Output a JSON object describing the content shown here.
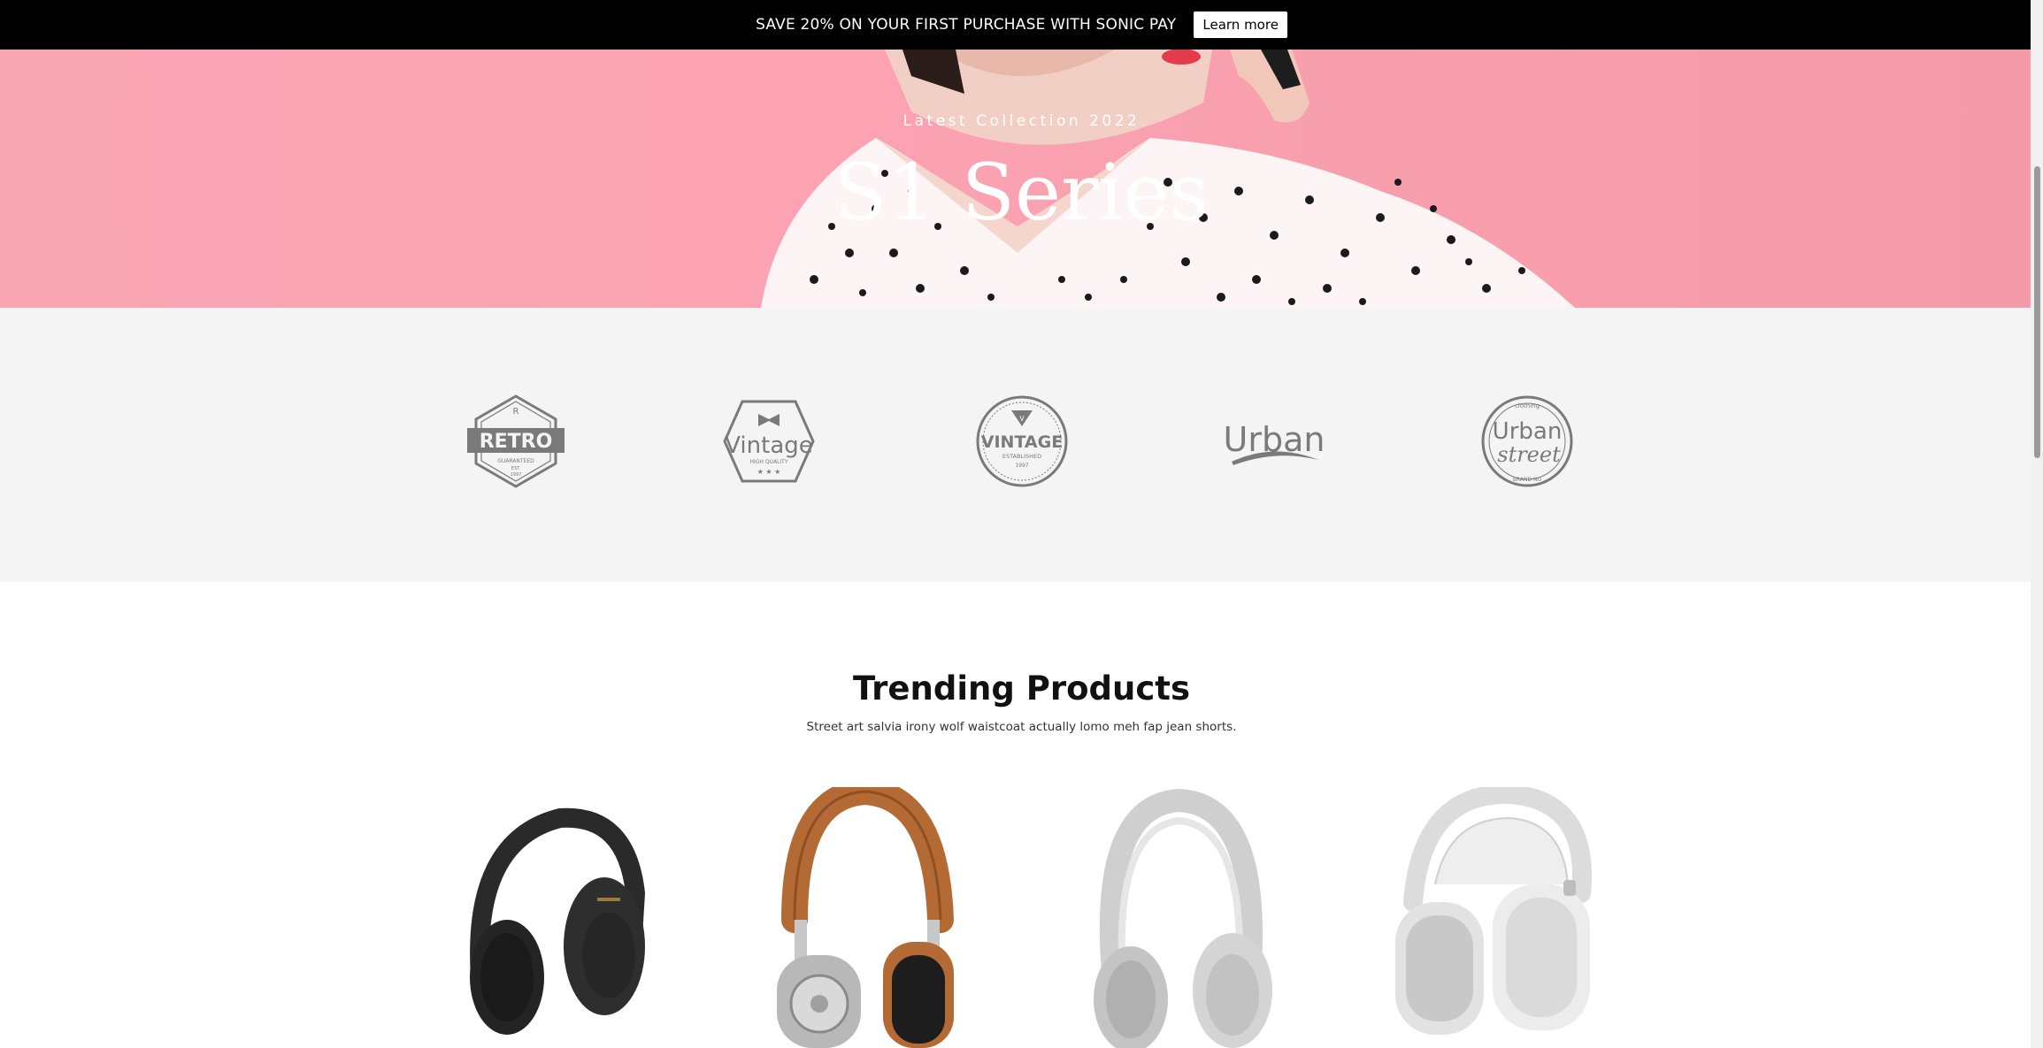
{
  "announcement": {
    "text": "SAVE 20% ON YOUR FIRST PURCHASE WITH SONIC PAY",
    "button_label": "Learn more"
  },
  "hero": {
    "subtitle": "Latest Collection 2022",
    "title": "S1 Series"
  },
  "brands": [
    {
      "name": "retro-logo",
      "lines": [
        "R",
        "RETRO",
        "GUARANTEED",
        "EST.",
        "1997"
      ]
    },
    {
      "name": "vintage-logo",
      "lines": [
        "Vintage",
        "HIGH QUALITY"
      ]
    },
    {
      "name": "vintage-established-logo",
      "lines": [
        "V",
        "VINTAGE",
        "ESTABLISHED",
        "1997"
      ]
    },
    {
      "name": "urban-logo",
      "lines": [
        "Urban"
      ]
    },
    {
      "name": "urban-street-logo",
      "lines": [
        "clothing",
        "Urban",
        "street",
        "BRAND NO"
      ]
    }
  ],
  "trending": {
    "title": "Trending Products",
    "subtitle": "Street art salvia irony wolf waistcoat actually lomo meh fap jean shorts."
  },
  "products": [
    {
      "name": "black-headphones",
      "color": "#2a2a2a"
    },
    {
      "name": "brown-leather-headphones",
      "color": "#b46a35"
    },
    {
      "name": "silver-headphones",
      "color": "#cfcfcf"
    },
    {
      "name": "white-over-ear-headphones",
      "color": "#e3e3e3"
    }
  ],
  "colors": {
    "topbar_bg": "#000000",
    "hero_bg": "#fca3b3",
    "brands_bg": "#f4f4f4",
    "logo_gray": "#7a7a7a"
  }
}
